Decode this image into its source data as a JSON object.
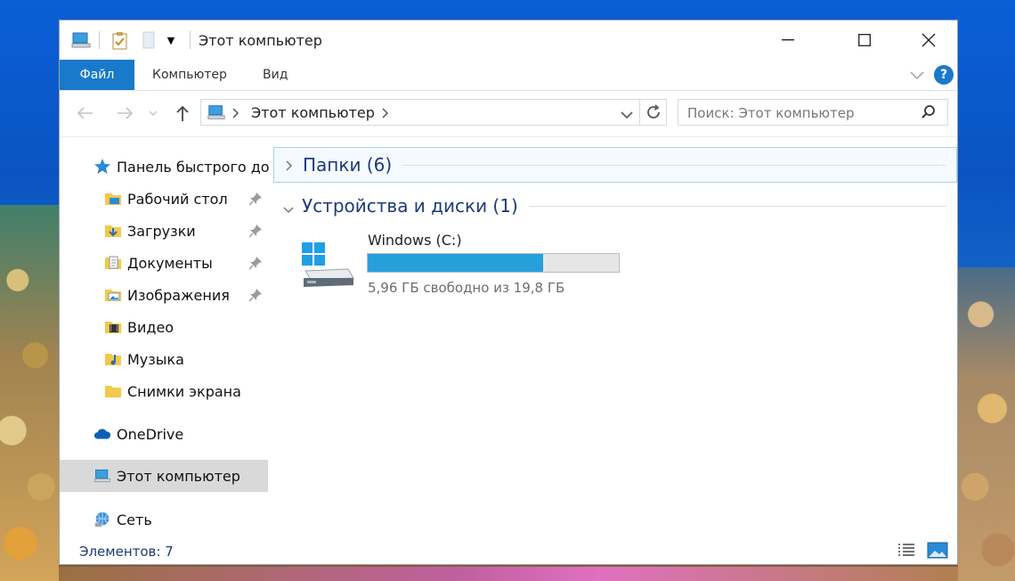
{
  "window": {
    "title": "Этот компьютер",
    "controls": {
      "minimize": "minimize-icon",
      "maximize": "maximize-icon",
      "close": "close-icon"
    }
  },
  "ribbon": {
    "tabs": [
      {
        "label": "Файл",
        "active": true
      },
      {
        "label": "Компьютер",
        "active": false
      },
      {
        "label": "Вид",
        "active": false
      }
    ],
    "help": "?"
  },
  "navbar": {
    "address_path": "Этот компьютер",
    "search_placeholder": "Поиск: Этот компьютер"
  },
  "sidebar": {
    "quick_access": "Панель быстрого до",
    "items": [
      {
        "label": "Рабочий стол",
        "icon": "desktop-folder-icon",
        "pinned": true
      },
      {
        "label": "Загрузки",
        "icon": "downloads-folder-icon",
        "pinned": true
      },
      {
        "label": "Документы",
        "icon": "documents-folder-icon",
        "pinned": true
      },
      {
        "label": "Изображения",
        "icon": "pictures-folder-icon",
        "pinned": true
      },
      {
        "label": "Видео",
        "icon": "videos-folder-icon",
        "pinned": false
      },
      {
        "label": "Музыка",
        "icon": "music-folder-icon",
        "pinned": false
      },
      {
        "label": "Снимки экрана",
        "icon": "screenshots-folder-icon",
        "pinned": false
      }
    ],
    "onedrive": "OneDrive",
    "this_pc": "Этот компьютер",
    "network": "Сеть"
  },
  "content": {
    "folders_group": "Папки (6)",
    "devices_group": "Устройства и диски (1)",
    "drive": {
      "name": "Windows (C:)",
      "free_text": "5,96 ГБ свободно из 19,8 ГБ",
      "used_fraction": 0.7
    }
  },
  "status": {
    "items_count": "Элементов: 7"
  },
  "colors": {
    "accent": "#1979ca",
    "drive_fill": "#26a0da",
    "group_title": "#1e3a78"
  }
}
